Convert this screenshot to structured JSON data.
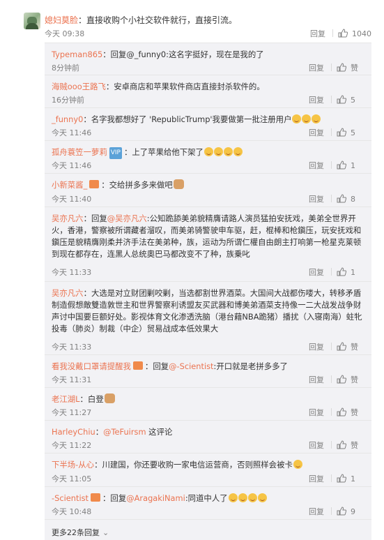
{
  "top_comment": {
    "user": "媳妇莫脸",
    "text": "：直接收购个小社交软件就行，直接引流。",
    "time": "今天 09:38",
    "reply_label": "回复",
    "likes": "1040"
  },
  "replies": [
    {
      "user": "Typeman865",
      "text": "：回复@_funny0:这名字挺好，现在是我的了",
      "time": "8分钟前",
      "reply_label": "回复",
      "likes": "赞"
    },
    {
      "user": "海贼ooo王路飞",
      "text": "：安卓商店和苹果软件商店直接封杀软件的。",
      "time": "16分钟前",
      "reply_label": "回复",
      "likes": "5"
    },
    {
      "user": "_funny0",
      "text": "：名字我都想好了 'RepublicTrump'我要做第一批注册用户",
      "time": "今天 11:46",
      "reply_label": "回复",
      "likes": "5"
    },
    {
      "user": "孤舟蓑笠一萝莉",
      "text": "：上了苹果给他下架了",
      "time": "今天 11:46",
      "reply_label": "回复",
      "likes": "1"
    },
    {
      "user": "小新菜酱_",
      "text": "：交给拼多多来做吧",
      "time": "今天 11:40",
      "reply_label": "回复",
      "likes": "8"
    },
    {
      "user": "吴亦凡六",
      "text_a": "：回复",
      "mention": "@吴亦凡六",
      "text_b": ":公知跪舔美弟貌精膺请路人演员猛拍安抚戏，美弟全世界开火，香港，警察被所谓藏者溜叹，而美弟骑警驶申车驱，赶，棍棒和枪鎭压，玩安抚戏和鎭压是貌精膺刚柔并济手法在美弟种，族，运动为所谓仁權自由朗主打响第一枪星克莱顿到现在都存在，连黑人总统奧巴马都改变不了种，族乗叱",
      "time": "今天 11:33",
      "reply_label": "回复",
      "likes": "1"
    },
    {
      "user": "吴亦凡六",
      "text": "：大选是对立财团剿咬剿，当选都割世界酒菜。大国间大战都伤喽大，转移矛盾制造假想敵雙造敦世主和世界警察利诱盟友买武器和博美弟酒菜支持像一二大战发战争财声讨中国要巨额好处。影视体育文化渗透洗脑（港台藉NBA跪猪）播扰（入寝南海）蛀牝投毒（肺炎）制裁（中企）贸易战成本低效果大",
      "time": "今天 11:33",
      "reply_label": "回复",
      "likes": "赞"
    },
    {
      "user": "看我没戴口罩请提醒我",
      "text_a": "：回复",
      "mention": "@-Scientist",
      "text_b": ":开口就是老拼多多了",
      "time": "今天 11:31",
      "reply_label": "回复",
      "likes": "赞"
    },
    {
      "user": "老江湖L",
      "text": "：白登",
      "time": "今天 11:27",
      "reply_label": "回复",
      "likes": "赞"
    },
    {
      "user": "HarleyChiu",
      "text_a": "：",
      "mention": "@TeFuirsm",
      "text_b": " 这评论",
      "time": "今天 11:22",
      "reply_label": "回复",
      "likes": "赞"
    },
    {
      "user": "下半场-从心",
      "text": "：川建国，你还要收购一家电信运营商，否则照样会被卡",
      "time": "今天 11:05",
      "reply_label": "回复",
      "likes": "1"
    },
    {
      "user": "-Scientist",
      "text_a": "：回复",
      "mention": "@AragakiNami",
      "text_b": ":同道中人了",
      "time": "今天 10:48",
      "reply_label": "回复",
      "likes": "9"
    }
  ],
  "more_replies": "更多22条回复",
  "colors": {
    "username": "#eb7350",
    "text": "#333333",
    "meta": "#808080",
    "panel": "#f2f2f5"
  },
  "icons": {
    "like": "thumbs-up-icon",
    "more": "chevron-down-icon"
  }
}
